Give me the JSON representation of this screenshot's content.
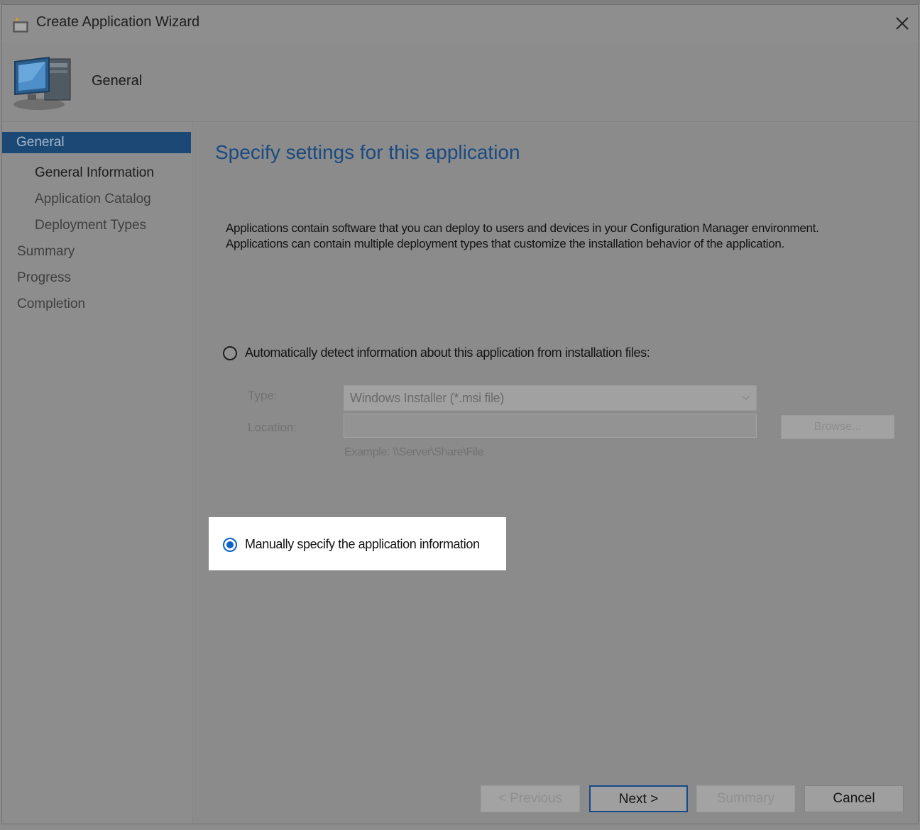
{
  "window": {
    "title": "Create Application Wizard",
    "close_symbol": "✕"
  },
  "header": {
    "title": "General",
    "icon": "computer-icon"
  },
  "sidebar": {
    "items": [
      {
        "label": "General",
        "state": "active"
      },
      {
        "label": "General Information",
        "state": "current"
      },
      {
        "label": "Application Catalog",
        "state": "normal"
      },
      {
        "label": "Deployment Types",
        "state": "normal"
      },
      {
        "label": "Summary",
        "state": "normal"
      },
      {
        "label": "Progress",
        "state": "normal"
      },
      {
        "label": "Completion",
        "state": "normal"
      }
    ]
  },
  "main": {
    "heading": "Specify settings for this application",
    "description_line1": "Applications contain software that you can deploy to users and devices in your Configuration Manager environment.",
    "description_line2": "Applications can contain multiple deployment types that customize the installation behavior of the application.",
    "auto_detect": {
      "label": "Automatically detect information about this application from installation files:",
      "selected": false
    },
    "type_label": "Type:",
    "type_value": "Windows Installer (*.msi file)",
    "location_label": "Location:",
    "location_value": "",
    "browse_label": "Browse...",
    "example": "Example: \\\\Server\\Share\\File",
    "manual": {
      "label": "Manually specify the application information",
      "selected": true
    }
  },
  "footer": {
    "previous": "< Previous",
    "next": "Next >",
    "summary": "Summary",
    "cancel": "Cancel"
  },
  "colors": {
    "accent": "#1c4876",
    "heading": "#1a4a80",
    "radio_selected": "#0b63c8"
  }
}
